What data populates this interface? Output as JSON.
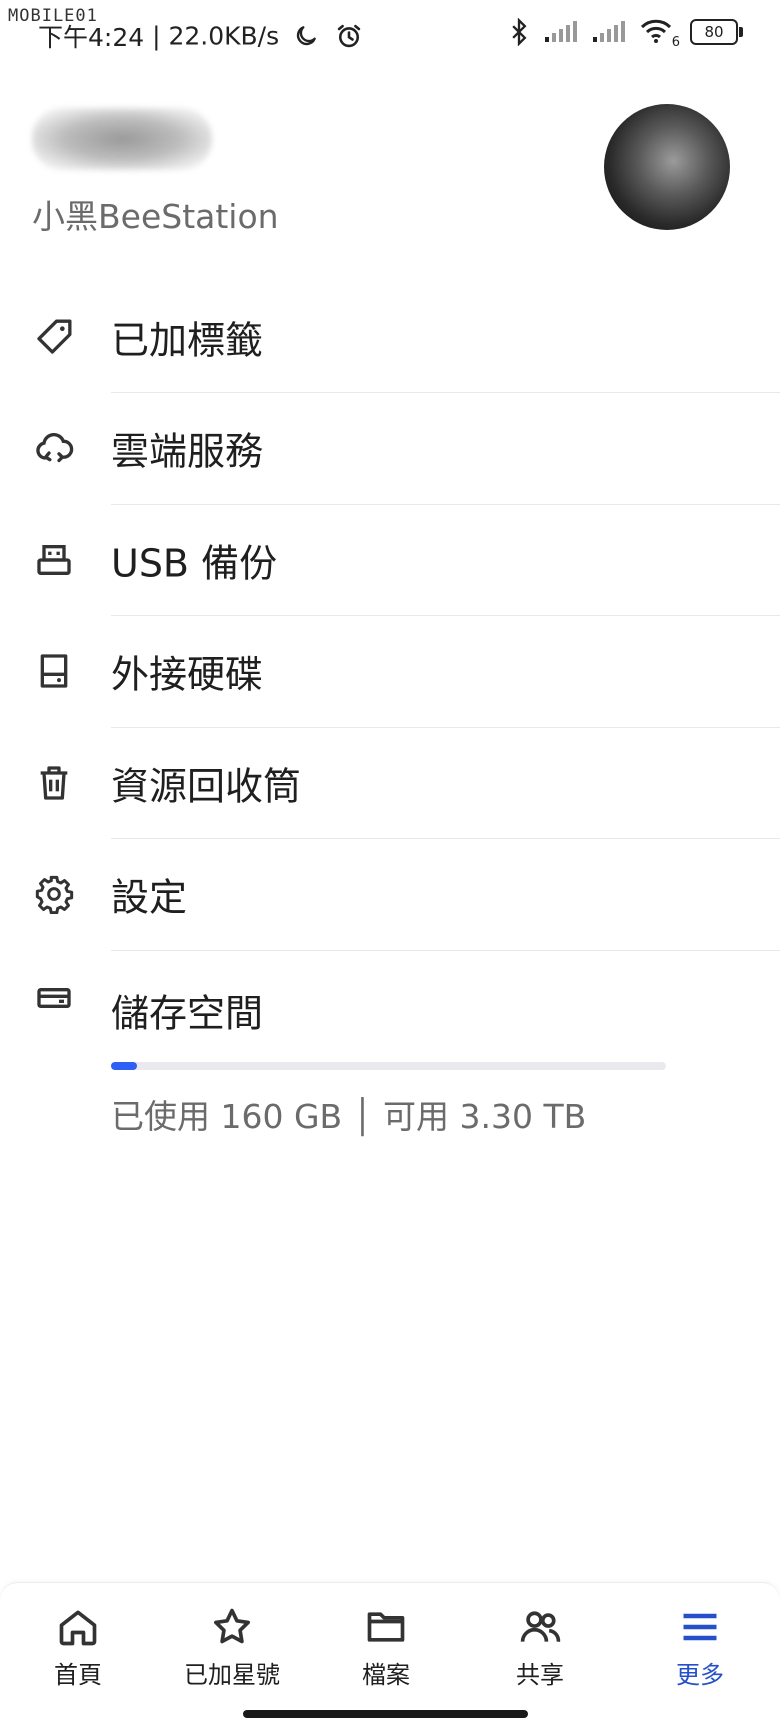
{
  "watermark": "MOBILE01",
  "status_bar": {
    "time": "下午4:24",
    "speed": "22.0KB/s",
    "battery": "80",
    "wifi_badge": "6",
    "icons": [
      "moon-icon",
      "alarm-icon",
      "bluetooth-icon",
      "signal-icon",
      "signal-icon",
      "wifi-icon",
      "battery-icon"
    ]
  },
  "profile": {
    "device_name": "小黑BeeStation"
  },
  "menu": [
    {
      "label": "已加標籤",
      "icon": "tag-icon"
    },
    {
      "label": "雲端服務",
      "icon": "cloud-sync-icon"
    },
    {
      "label": "USB 備份",
      "icon": "usb-icon"
    },
    {
      "label": "外接硬碟",
      "icon": "external-drive-icon"
    },
    {
      "label": "資源回收筒",
      "icon": "trash-icon"
    },
    {
      "label": "設定",
      "icon": "gear-icon"
    },
    {
      "label": "儲存空間",
      "icon": "storage-icon"
    }
  ],
  "storage": {
    "used_fraction": 0.046,
    "text": "已使用 160 GB │ 可用 3.30 TB",
    "bar_color": "#2f5ff5"
  },
  "bottom_nav": [
    {
      "label": "首頁",
      "icon": "home-icon",
      "active": false
    },
    {
      "label": "已加星號",
      "icon": "star-icon",
      "active": false
    },
    {
      "label": "檔案",
      "icon": "folder-icon",
      "active": false
    },
    {
      "label": "共享",
      "icon": "people-icon",
      "active": false
    },
    {
      "label": "更多",
      "icon": "menu-icon",
      "active": true
    }
  ],
  "colors": {
    "accent": "#2550c9",
    "text": "#1f1f1f",
    "muted": "#6b6b6b"
  }
}
